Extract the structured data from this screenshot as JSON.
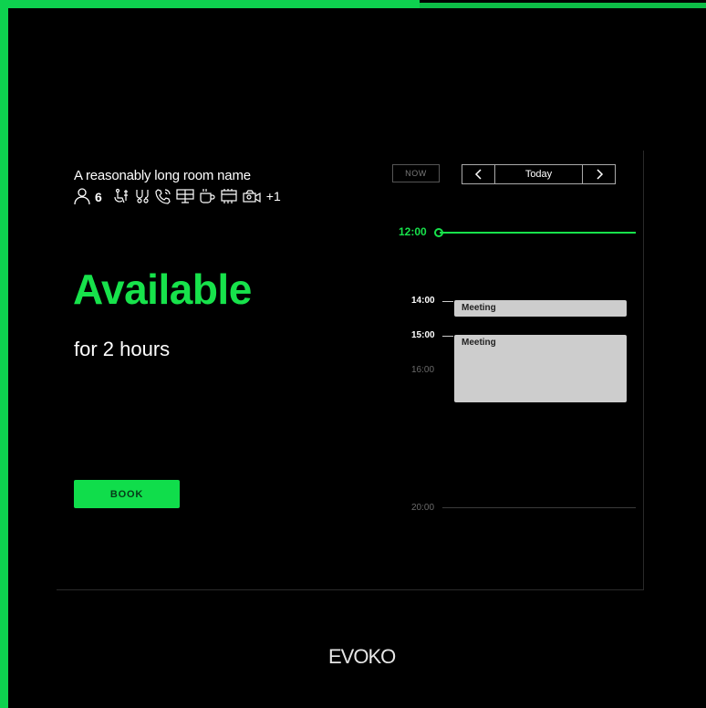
{
  "room": {
    "name": "A reasonably long room name",
    "capacity": "6",
    "amenities": [
      "accessibility-icon",
      "wifi-icon",
      "phone-icon",
      "screen-icon",
      "coffee-icon",
      "projector-icon",
      "video-camera-icon"
    ],
    "more_count": "+1"
  },
  "status": {
    "label": "Available",
    "duration": "for 2 hours"
  },
  "book_label": "BOOK",
  "calendar": {
    "now_label": "NOW",
    "day_label": "Today",
    "current_time": "12:00",
    "hours": {
      "h14": "14:00",
      "h15": "15:00",
      "h16": "16:00",
      "h20": "20:00"
    },
    "events": [
      {
        "title": "Meeting",
        "start": "14:00"
      },
      {
        "title": "Meeting",
        "start": "15:00"
      }
    ]
  },
  "brand": "EVOKO",
  "colors": {
    "accent": "#17e24b",
    "background": "#000000",
    "event": "#cdcdcd"
  }
}
